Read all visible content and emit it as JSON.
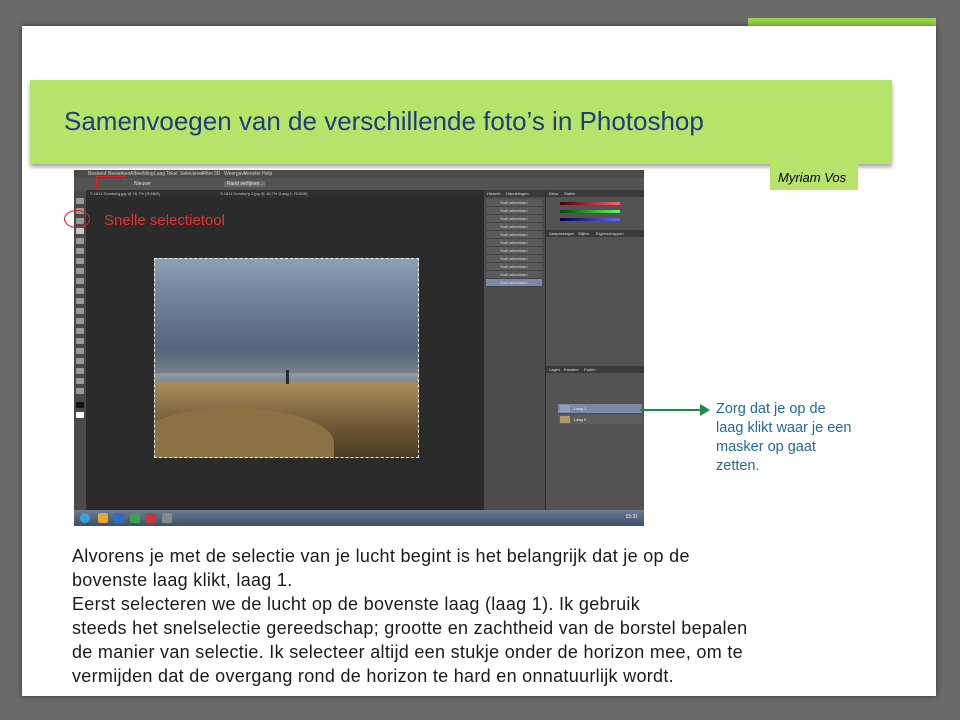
{
  "slide": {
    "title": "Samenvoegen van de verschillende foto’s in Photoshop",
    "author": "Myriam Vos"
  },
  "annotations": {
    "tool_label": "Snelle selectietool",
    "note_lines": [
      "Zorg dat je op de",
      "laag klikt waar je een",
      "masker op gaat",
      "zetten."
    ],
    "highlight_color": "#e01e1e",
    "arrow_color": "#1e8a4a"
  },
  "body": {
    "lines": [
      "Alvorens je met de selectie van je lucht begint is het belangrijk dat je op de",
      "bovenste laag klikt, laag 1.",
      "Eerst selecteren we de lucht op de bovenste laag (laag 1). Ik gebruik",
      "steeds het snelselectie gereedschap; grootte en zachtheid van de borstel bepalen",
      "de manier van selectie. Ik selecteer altijd een stukje onder de horizon mee, om te",
      "vermijden dat de overgang rond de horizon te hard en onnatuurlijk wordt."
    ]
  },
  "photoshop": {
    "menu": [
      "Bestand",
      "Bewerken",
      "Afbeelding",
      "Laag",
      "Tekst",
      "Selecteren",
      "Filter",
      "3D",
      "Weergave",
      "Venster",
      "Help"
    ],
    "options": [
      "Nieuwe",
      "Rand verfijnen..."
    ],
    "tabs": [
      "S 1811 Domburg.jpg @ 16,7% (RGB/8)",
      "S 1811 Domburg 2.jpg @ 16,7% (Laag 1, RGB/8)"
    ],
    "history_tabs": [
      "Historie",
      "Handelingen"
    ],
    "history_items": [
      "Snel selecteren",
      "Snel selecteren",
      "Snel selecteren",
      "Snel selecteren",
      "Snel selecteren",
      "Snel selecteren",
      "Snel selecteren",
      "Snel selecteren",
      "Snel selecteren",
      "Snel selecteren",
      "Snel selecteren"
    ],
    "color_tabs": [
      "Kleur",
      "Stalen"
    ],
    "adjust_tabs": [
      "Aanpassingen",
      "Stijlen",
      "Eigenschappen"
    ],
    "layers_tabs": [
      "Lagen",
      "Kanalen",
      "Paden"
    ],
    "layers": [
      "Laag 1",
      "Laag 0"
    ],
    "status": "16,67%   Doc: 63,3M/63,3M",
    "clock": "15:31"
  }
}
